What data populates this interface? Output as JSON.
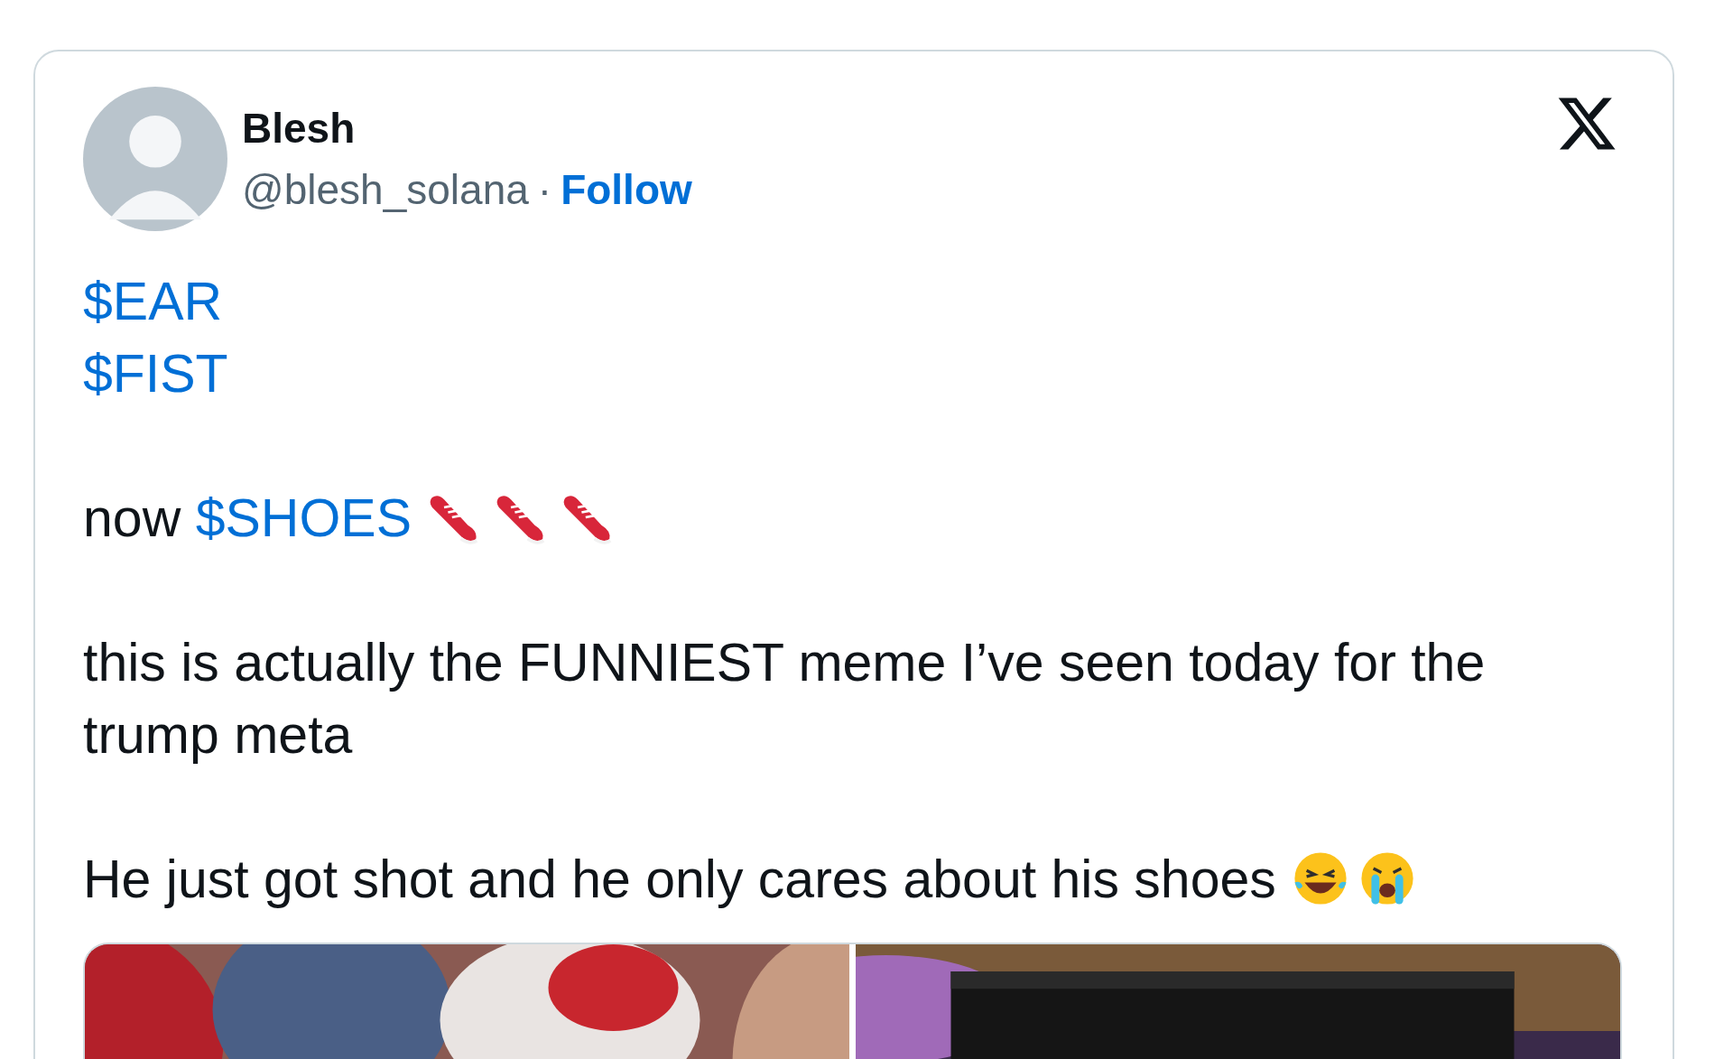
{
  "author": {
    "name": "Blesh",
    "handle": "@blesh_solana",
    "separator": "·",
    "follow": "Follow"
  },
  "paragraphs": [
    {
      "parts": [
        {
          "kind": "link",
          "text": "$EAR"
        },
        {
          "kind": "break"
        },
        {
          "kind": "link",
          "text": "$FIST"
        }
      ]
    },
    {
      "parts": [
        {
          "kind": "text",
          "text": "now "
        },
        {
          "kind": "link",
          "text": "$SHOES"
        },
        {
          "kind": "sneaker"
        },
        {
          "kind": "sneaker"
        },
        {
          "kind": "sneaker"
        }
      ]
    },
    {
      "parts": [
        {
          "kind": "text",
          "text": "this is actually the FUNNIEST meme I’ve seen today for the trump meta"
        }
      ]
    },
    {
      "parts": [
        {
          "kind": "text",
          "text": "He just got shot and he only cares about his shoes "
        },
        {
          "kind": "laughing"
        },
        {
          "kind": "crying"
        }
      ]
    }
  ]
}
